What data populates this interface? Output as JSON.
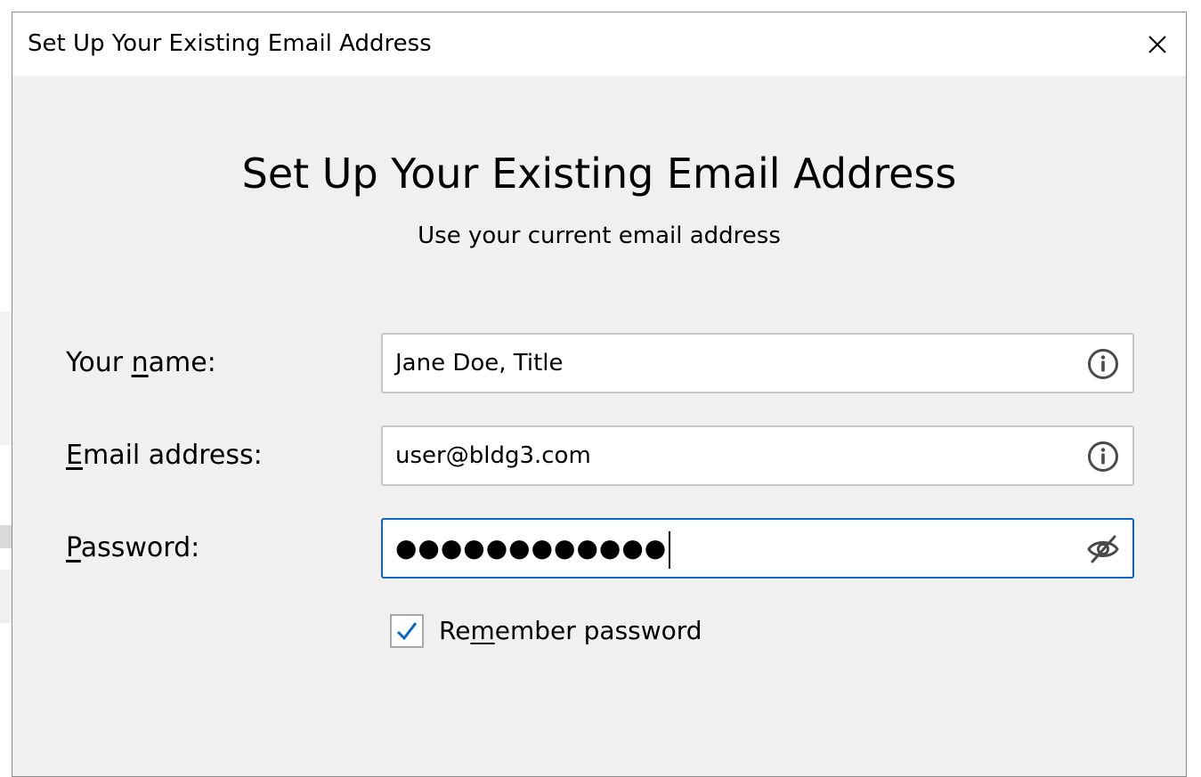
{
  "dialog": {
    "window_title": "Set Up Your Existing Email Address",
    "close_icon": "close-icon"
  },
  "header": {
    "title": "Set Up Your Existing Email Address",
    "subtitle": "Use your current email address"
  },
  "form": {
    "name": {
      "label_pre": "Your ",
      "label_accel": "n",
      "label_post": "ame:",
      "value": "Jane Doe, Title",
      "icon": "info-icon"
    },
    "email": {
      "label_pre": "",
      "label_accel": "E",
      "label_post": "mail address:",
      "value": "user@bldg3.com",
      "icon": "info-icon"
    },
    "password": {
      "label_pre": "",
      "label_accel": "P",
      "label_post": "assword:",
      "value_masked": "●●●●●●●●●●●●",
      "icon": "eye-slash-icon"
    },
    "remember": {
      "label_pre": "Re",
      "label_accel": "m",
      "label_post": "ember password",
      "checked": true
    }
  },
  "colors": {
    "accent": "#0a66c2",
    "dialog_bg": "#f0f0f0",
    "titlebar_bg": "#ffffff",
    "field_border": "#c6c6c6"
  }
}
